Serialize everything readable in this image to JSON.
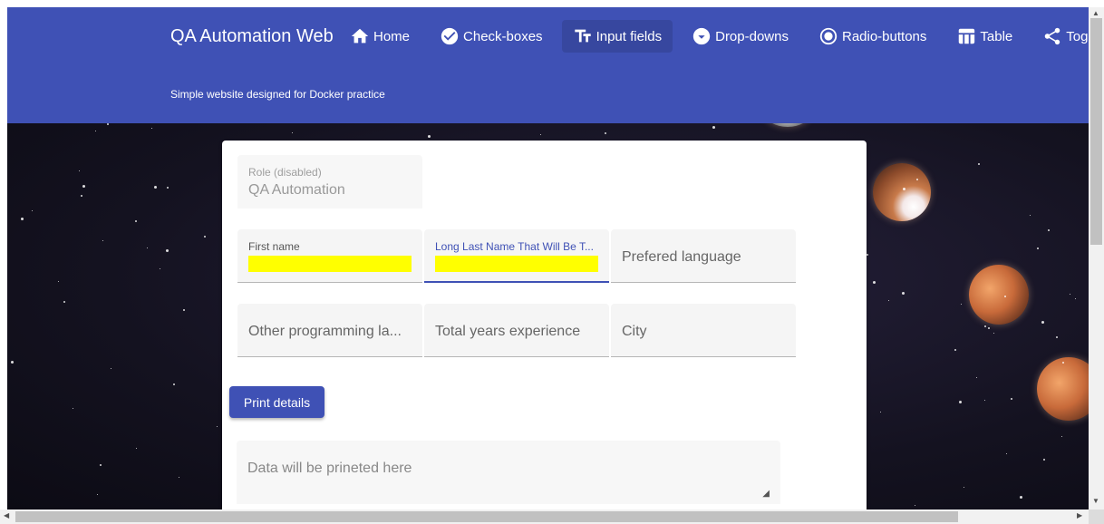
{
  "header": {
    "brand": "QA Automation Web",
    "subtitle": "Simple website designed for Docker practice",
    "nav": [
      {
        "label": "Home",
        "icon": "home-icon"
      },
      {
        "label": "Check-boxes",
        "icon": "check-circle-icon"
      },
      {
        "label": "Input fields",
        "icon": "text-fields-icon",
        "active": true
      },
      {
        "label": "Drop-downs",
        "icon": "dropdown-circle-icon"
      },
      {
        "label": "Radio-buttons",
        "icon": "radio-button-icon"
      },
      {
        "label": "Table",
        "icon": "table-icon"
      },
      {
        "label": "Toggles",
        "icon": "share-icon"
      }
    ]
  },
  "form": {
    "role": {
      "label": "Role (disabled)",
      "value": "QA Automation"
    },
    "first_name": {
      "label": "First name",
      "value": ""
    },
    "last_name": {
      "label": "Long Last Name That Will Be T...",
      "value": ""
    },
    "preferred_language": {
      "placeholder": "Prefered language"
    },
    "other_languages": {
      "placeholder": "Other programming la..."
    },
    "years_experience": {
      "placeholder": "Total years experience"
    },
    "city": {
      "placeholder": "City"
    },
    "print_button": "Print details",
    "output": {
      "placeholder": "Data will be prineted here"
    }
  },
  "colors": {
    "primary": "#3f51b5",
    "highlight": "#ffff00"
  }
}
